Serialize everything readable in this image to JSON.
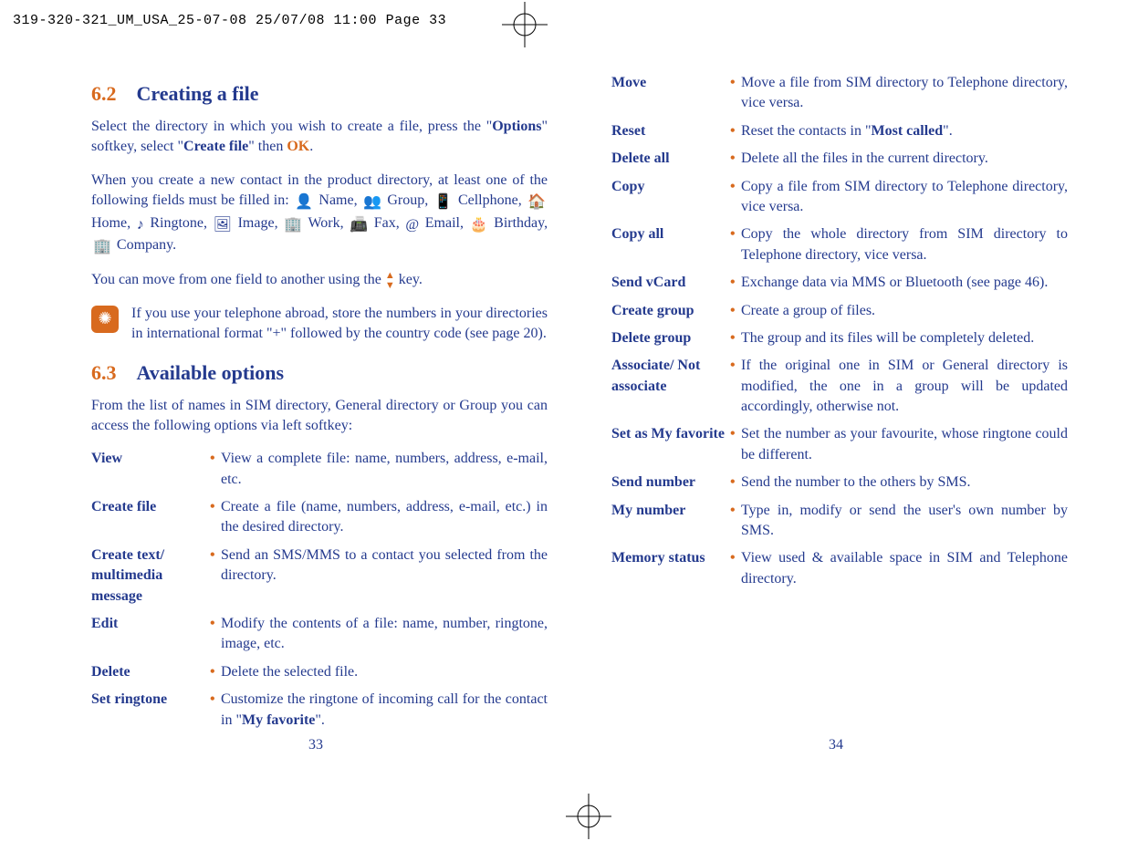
{
  "header": "319-320-321_UM_USA_25-07-08  25/07/08  11:00  Page 33",
  "sections": {
    "s62": {
      "num": "6.2",
      "title": "Creating a file"
    },
    "s63": {
      "num": "6.3",
      "title": "Available options"
    }
  },
  "paras": {
    "p1a": "Select the directory in which you wish to create a file, press the \"",
    "p1b": "Options",
    "p1c": "\" softkey, select \"",
    "p1d": "Create file",
    "p1e": "\" then ",
    "p1f": "OK",
    "p1g": ".",
    "p2": "When you create a new contact in the product directory, at least one of the following fields must be filled in:",
    "fields": [
      "Name,",
      "Group,",
      "Cellphone,",
      "Home,",
      "Ringtone,",
      "Image,",
      "Work,",
      "Fax,",
      "Email,",
      "Birthday,",
      "Company."
    ],
    "p3a": "You can move from one field to another using the ",
    "p3b": " key.",
    "note": "If you use your telephone abroad, store the numbers in your directories in international format \"+\" followed by the country code (see page 20).",
    "p4": "From the list of names in SIM directory, General directory or Group you can access the following options via left softkey:"
  },
  "options_left": [
    {
      "label": "View",
      "desc": "View a complete file: name, numbers, address, e-mail, etc."
    },
    {
      "label": "Create file",
      "desc": "Create a file (name, numbers, address, e-mail, etc.) in the desired directory."
    },
    {
      "label": "Create text/ multimedia message",
      "desc": "Send an SMS/MMS to a contact you selected from the directory."
    },
    {
      "label": "Edit",
      "desc": "Modify the contents of a file: name, number, ringtone, image, etc."
    },
    {
      "label": "Delete",
      "desc": "Delete the selected file."
    },
    {
      "label": "Set ringtone",
      "desc_a": "Customize the ringtone of incoming call for the contact in \"",
      "desc_b": "My favorite",
      "desc_c": "\"."
    }
  ],
  "options_right": [
    {
      "label": "Move",
      "desc": "Move a file from SIM directory to Telephone directory, vice versa."
    },
    {
      "label": "Reset",
      "desc_a": "Reset the contacts in \"",
      "desc_b": "Most called",
      "desc_c": "\"."
    },
    {
      "label": "Delete all",
      "desc": "Delete all the files in the current directory."
    },
    {
      "label": "Copy",
      "desc": "Copy a file from SIM directory to Telephone directory, vice versa."
    },
    {
      "label": "Copy all",
      "desc": "Copy the whole directory from SIM directory to Telephone directory, vice versa."
    },
    {
      "label": "Send vCard",
      "desc": "Exchange data via MMS or Bluetooth (see page 46)."
    },
    {
      "label": "Create group",
      "desc": "Create a group of files."
    },
    {
      "label": "Delete group",
      "desc": "The group and its files will be completely deleted."
    },
    {
      "label": "Associate/ Not associate",
      "desc": "If the original one in SIM or General directory is modified, the one in a group will be updated accordingly, otherwise not."
    },
    {
      "label": "Set as My favorite",
      "desc": "Set the number as your favourite, whose ringtone could be different."
    },
    {
      "label": "Send number",
      "desc": "Send the number to the others by SMS."
    },
    {
      "label": "My number",
      "desc": "Type in, modify or send the user's own number by SMS."
    },
    {
      "label": "Memory status",
      "desc": "View used & available space in SIM and Telephone directory."
    }
  ],
  "page_numbers": {
    "left": "33",
    "right": "34"
  },
  "icons": {
    "tip": "✺",
    "name": "👤",
    "group": "👥",
    "cell": "📱",
    "home": "🏠",
    "ring": "♪",
    "image": "🖼",
    "work": "🏢",
    "fax": "📠",
    "email": "@",
    "bday": "🎂",
    "company": "🏢",
    "arrow": "▲▼"
  }
}
